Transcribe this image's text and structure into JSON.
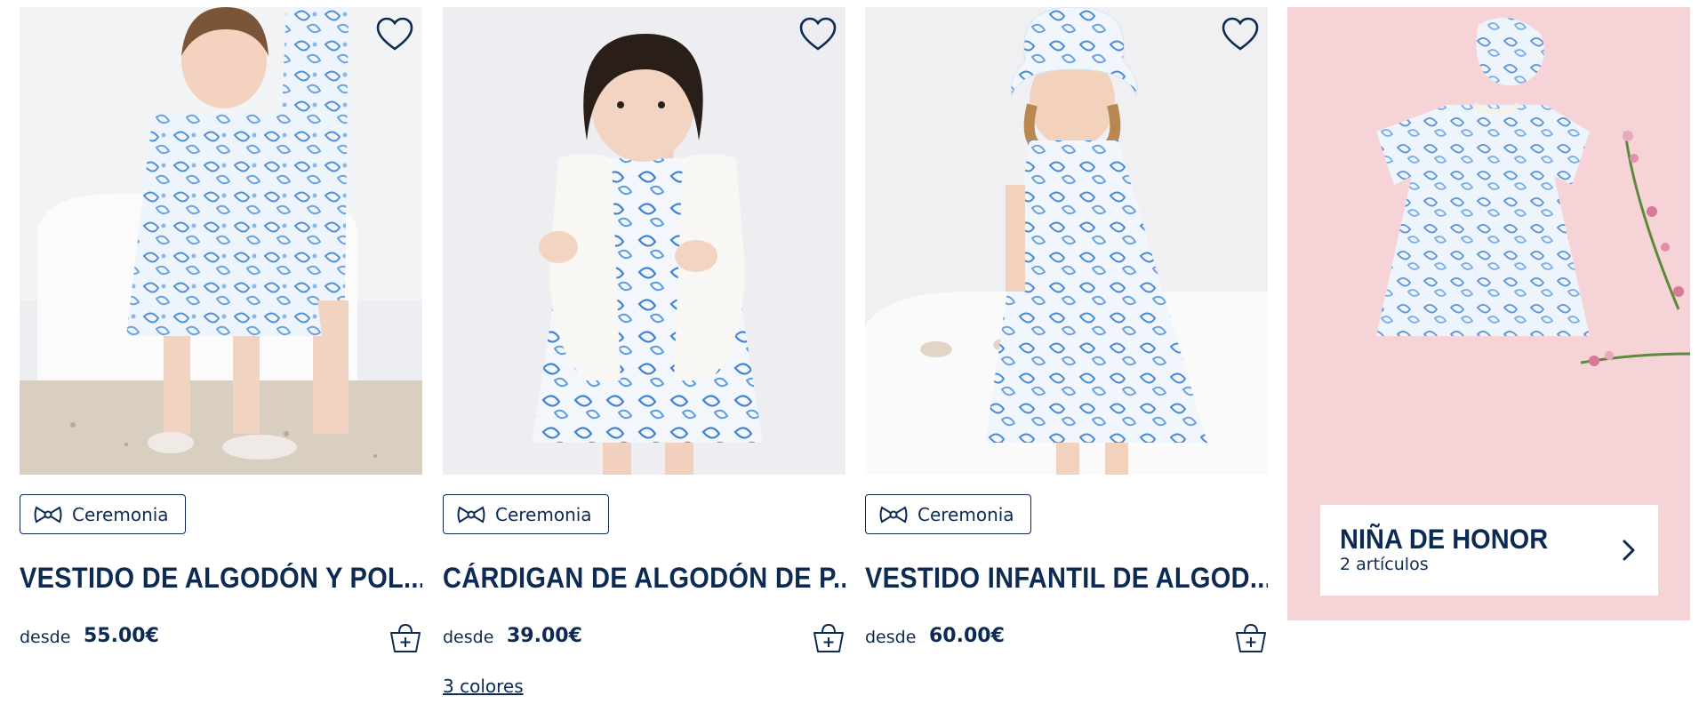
{
  "products": [
    {
      "badge": "Ceremonia",
      "title": "VESTIDO DE ALGODÓN Y POL...",
      "from_label": "desde",
      "price": "55.00€",
      "colors_link": ""
    },
    {
      "badge": "Ceremonia",
      "title": "CÁRDIGAN DE ALGODÓN DE P...",
      "from_label": "desde",
      "price": "39.00€",
      "colors_link": "3 colores"
    },
    {
      "badge": "Ceremonia",
      "title": "VESTIDO INFANTIL DE ALGOD...",
      "from_label": "desde",
      "price": "60.00€",
      "colors_link": ""
    }
  ],
  "promo": {
    "title": "NIÑA DE HONOR",
    "subtitle": "2 artículos"
  },
  "icons": {
    "favorite": "heart-outline-icon",
    "cart": "basket-add-icon",
    "badge": "bow-tie-icon",
    "promo_arrow": "chevron-right-icon"
  },
  "colors": {
    "brand_navy": "#0c2a52",
    "pattern_blue": "#4f8fd6",
    "promo_pink": "#f6d3d6"
  }
}
